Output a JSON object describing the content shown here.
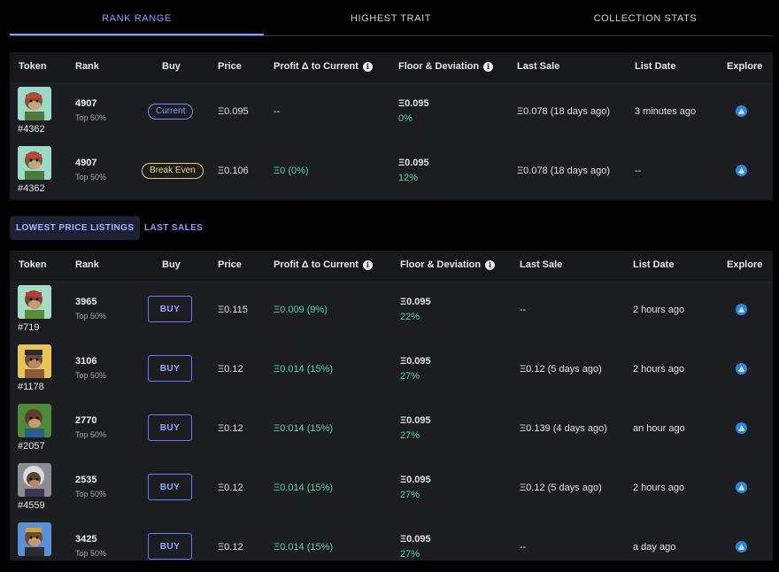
{
  "tabs": [
    {
      "label": "RANK RANGE",
      "active": true
    },
    {
      "label": "HIGHEST TRAIT",
      "active": false
    },
    {
      "label": "COLLECTION STATS",
      "active": false
    }
  ],
  "columns": {
    "token": "Token",
    "rank": "Rank",
    "buy": "Buy",
    "price": "Price",
    "profit": "Profit Δ to Current",
    "floor": "Floor & Deviation",
    "last_sale": "Last Sale",
    "list_date": "List Date",
    "explore": "Explore"
  },
  "info_glyph": "i",
  "rank_range_rows": [
    {
      "token": "#4362",
      "rank": "4907",
      "rank_sub": "Top 50%",
      "buy": "Current",
      "price": "Ξ0.095",
      "profit": "--",
      "floor": "Ξ0.095",
      "deviation": "0%",
      "last_sale": "Ξ0.078 (18 days ago)",
      "list_date": "3 minutes ago"
    },
    {
      "token": "#4362",
      "rank": "4907",
      "rank_sub": "Top 50%",
      "buy": "Break Even",
      "price": "Ξ0.106",
      "profit": "Ξ0 (0%)",
      "floor": "Ξ0.095",
      "deviation": "12%",
      "last_sale": "Ξ0.078 (18 days ago)",
      "list_date": "--"
    }
  ],
  "subtabs": [
    {
      "label": "LOWEST PRICE LISTINGS",
      "active": true
    },
    {
      "label": "LAST SALES",
      "active": false
    }
  ],
  "listing_rows": [
    {
      "token": "#719",
      "rank": "3965",
      "rank_sub": "Top 50%",
      "buy": "BUY",
      "price": "Ξ0.115",
      "profit": "Ξ0.009 (9%)",
      "floor": "Ξ0.095",
      "deviation": "22%",
      "last_sale": "--",
      "list_date": "2 hours ago"
    },
    {
      "token": "#1178",
      "rank": "3106",
      "rank_sub": "Top 50%",
      "buy": "BUY",
      "price": "Ξ0.12",
      "profit": "Ξ0.014 (15%)",
      "floor": "Ξ0.095",
      "deviation": "27%",
      "last_sale": "Ξ0.12 (5 days ago)",
      "list_date": "2 hours ago"
    },
    {
      "token": "#2057",
      "rank": "2770",
      "rank_sub": "Top 50%",
      "buy": "BUY",
      "price": "Ξ0.12",
      "profit": "Ξ0.014 (15%)",
      "floor": "Ξ0.095",
      "deviation": "27%",
      "last_sale": "Ξ0.139 (4 days ago)",
      "list_date": "an hour ago"
    },
    {
      "token": "#4559",
      "rank": "2535",
      "rank_sub": "Top 50%",
      "buy": "BUY",
      "price": "Ξ0.12",
      "profit": "Ξ0.014 (15%)",
      "floor": "Ξ0.095",
      "deviation": "27%",
      "last_sale": "Ξ0.12 (5 days ago)",
      "list_date": "2 hours ago"
    },
    {
      "token": "",
      "rank": "3425",
      "rank_sub": "Top 50%",
      "buy": "BUY",
      "price": "Ξ0.12",
      "profit": "Ξ0.014 (15%)",
      "floor": "Ξ0.095",
      "deviation": "27%",
      "last_sale": "--",
      "list_date": "a day ago"
    }
  ],
  "colors": {
    "accent": "#8e9bff",
    "profit_green": "#5fd3a5",
    "break_even": "#f0d77a",
    "opensea_blue": "#2e86de"
  }
}
